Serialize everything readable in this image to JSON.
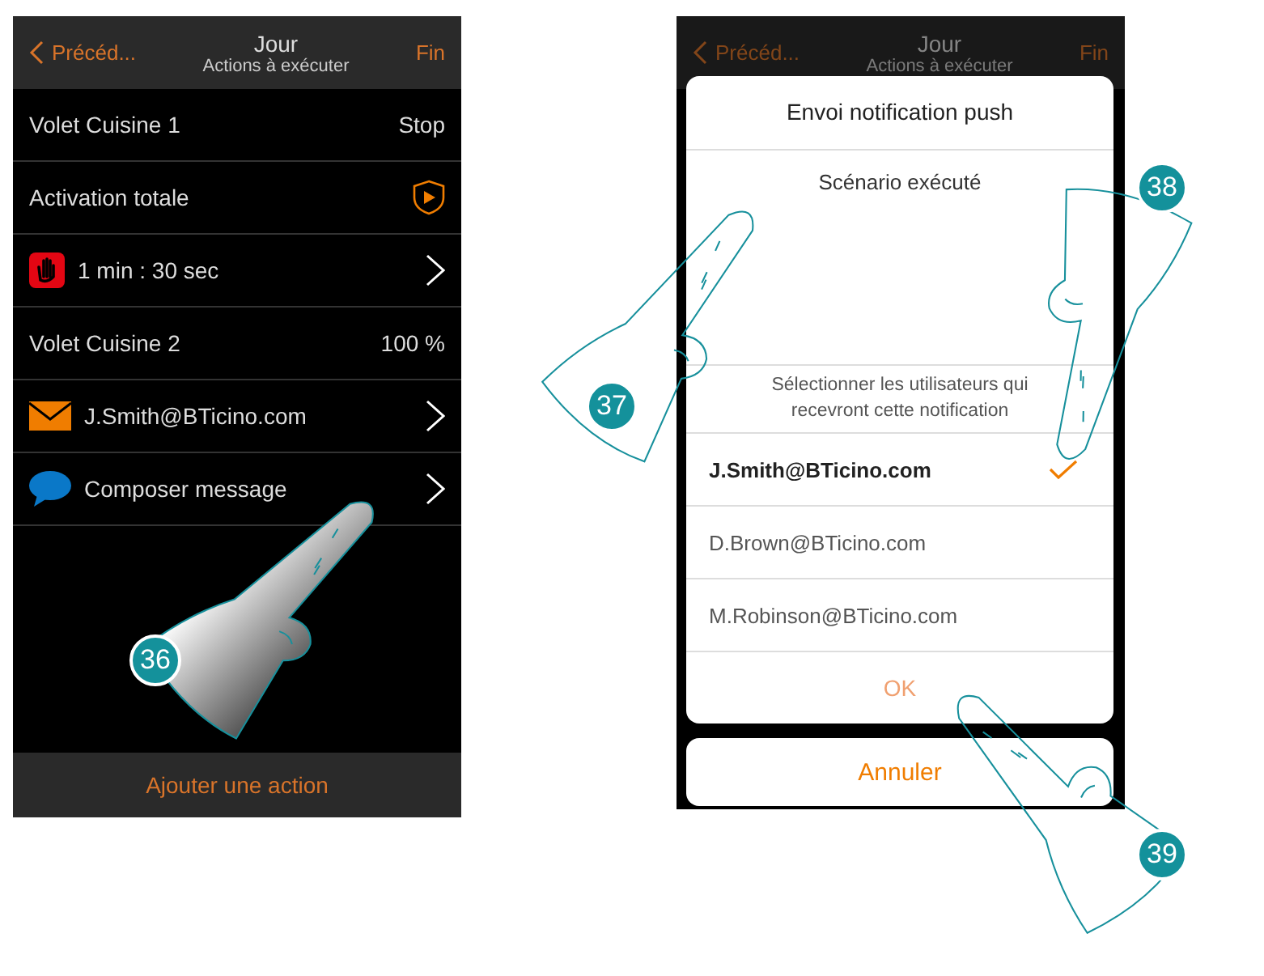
{
  "left_screen": {
    "header": {
      "back": "Précéd...",
      "title": "Jour",
      "subtitle": "Actions à exécuter",
      "done": "Fin"
    },
    "rows": [
      {
        "kind": "value",
        "label": "Volet Cuisine 1",
        "value": "Stop"
      },
      {
        "kind": "shield",
        "label": "Activation totale"
      },
      {
        "kind": "stop",
        "label": "1 min : 30 sec"
      },
      {
        "kind": "value",
        "label": "Volet Cuisine 2",
        "value": "100 %"
      },
      {
        "kind": "email",
        "label": "J.Smith@BTicino.com"
      },
      {
        "kind": "message",
        "label": "Composer message"
      }
    ],
    "footer": "Ajouter une action"
  },
  "right_screen": {
    "header": {
      "back": "Précéd...",
      "title": "Jour",
      "subtitle": "Actions à exécuter",
      "done": "Fin"
    },
    "dialog": {
      "title": "Envoi notification push",
      "message": "Scénario exécuté",
      "prompt": "Sélectionner les utilisateurs qui recevront cette notification",
      "users": [
        {
          "email": "J.Smith@BTicino.com",
          "selected": true
        },
        {
          "email": "D.Brown@BTicino.com",
          "selected": false
        },
        {
          "email": "M.Robinson@BTicino.com",
          "selected": false
        }
      ],
      "ok": "OK"
    },
    "cancel": "Annuler"
  },
  "callouts": [
    {
      "number": "36"
    },
    {
      "number": "37"
    },
    {
      "number": "38"
    },
    {
      "number": "39"
    }
  ]
}
